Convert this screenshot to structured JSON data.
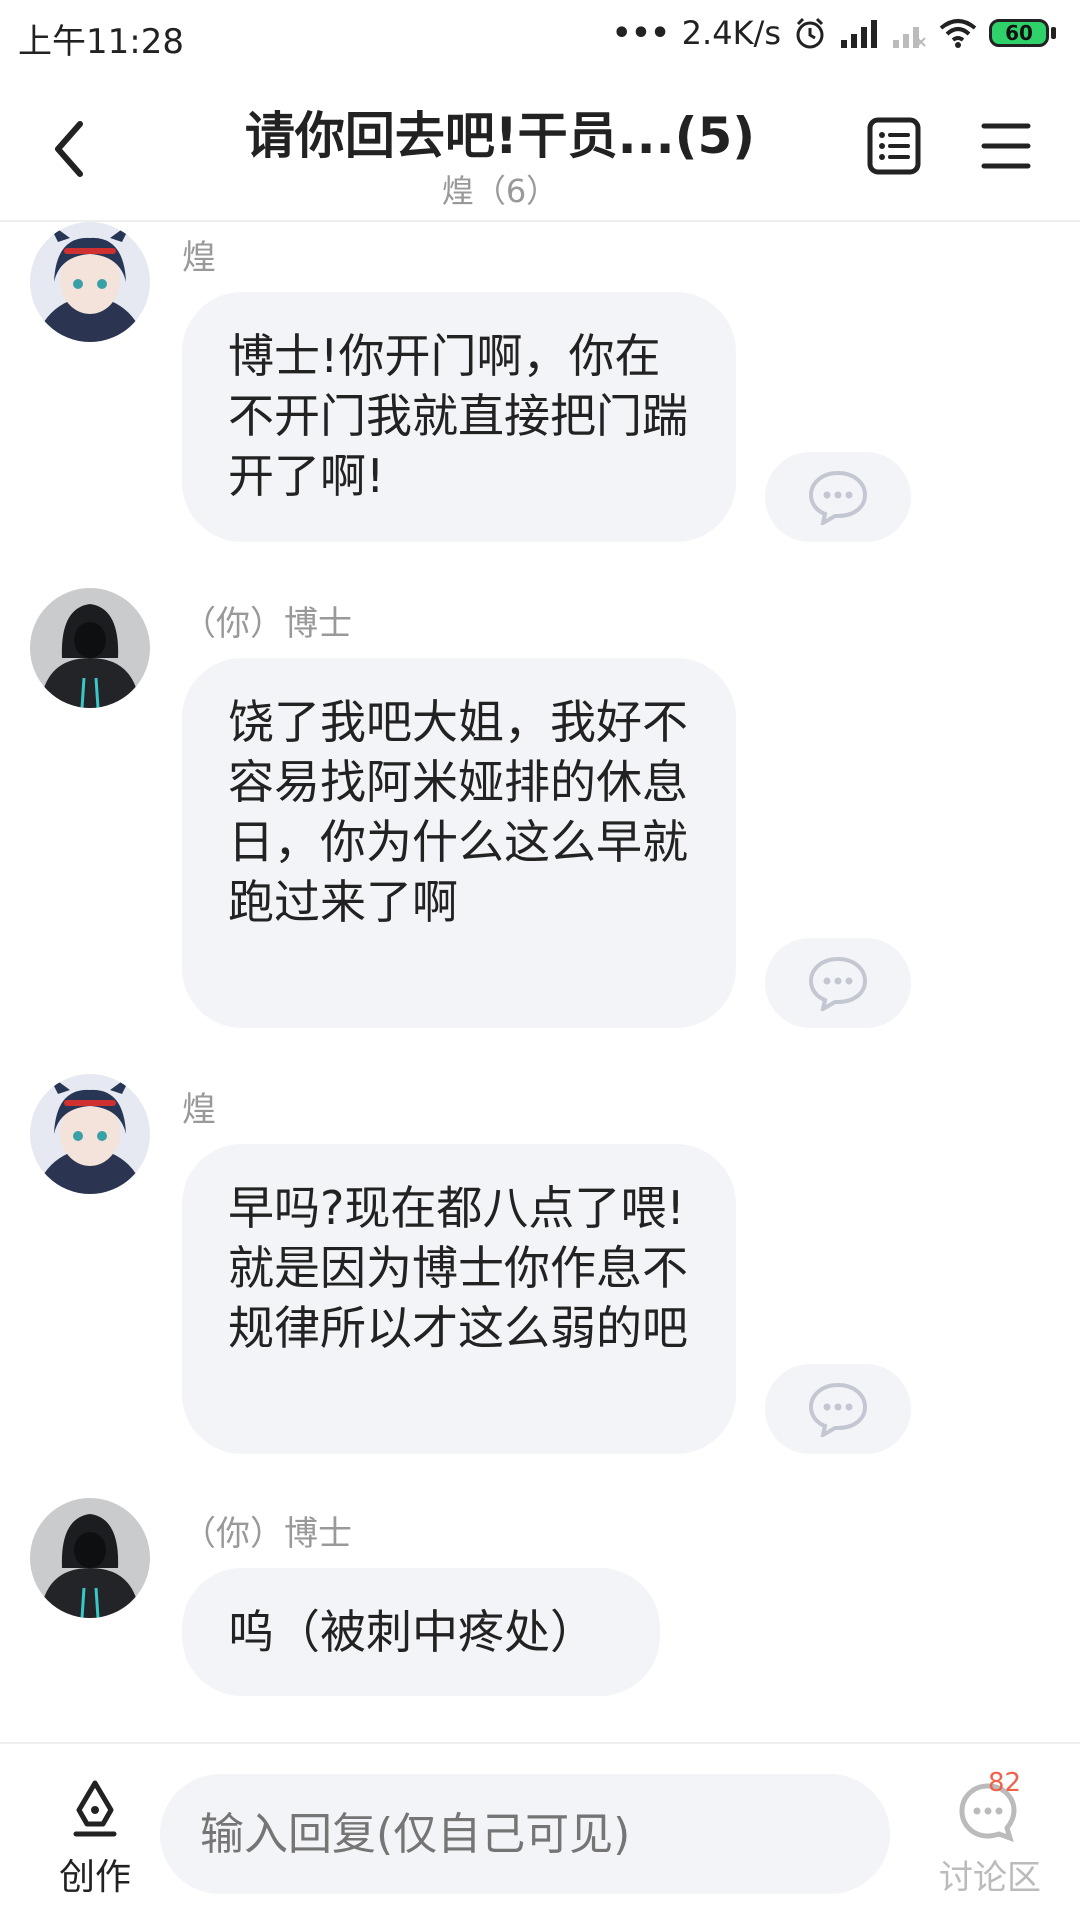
{
  "status_bar": {
    "time": "上午11:28",
    "net_speed": "2.4K/s",
    "battery": "60"
  },
  "header": {
    "title": "请你回去吧!干员...(5)",
    "subtitle": "煌（6）"
  },
  "messages": [
    {
      "sender": "煌",
      "text": "博士!你开门啊，你在不开门我就直接把门踹开了啊!"
    },
    {
      "sender": "（你）博士",
      "text": "饶了我吧大姐，我好不容易找阿米娅排的休息日，你为什么这么早就跑过来了啊"
    },
    {
      "sender": "煌",
      "text": "早吗?现在都八点了喂!就是因为博士你作息不规律所以才这么弱的吧"
    },
    {
      "sender": "（你）博士",
      "text": "呜（被刺中疼处）"
    }
  ],
  "bottom_bar": {
    "create_label": "创作",
    "reply_placeholder": "输入回复(仅自己可见)",
    "discuss_label": "讨论区",
    "discuss_count": "82"
  },
  "colors": {
    "bubble_bg": "#f3f4f7",
    "badge": "#f0624a",
    "battery": "#2fd16a"
  },
  "icons": [
    "back-arrow-icon",
    "list-icon",
    "menu-icon",
    "comment-icon",
    "pen-nib-icon",
    "discussion-icon",
    "alarm-icon",
    "signal-icon",
    "wifi-icon",
    "battery-icon"
  ]
}
